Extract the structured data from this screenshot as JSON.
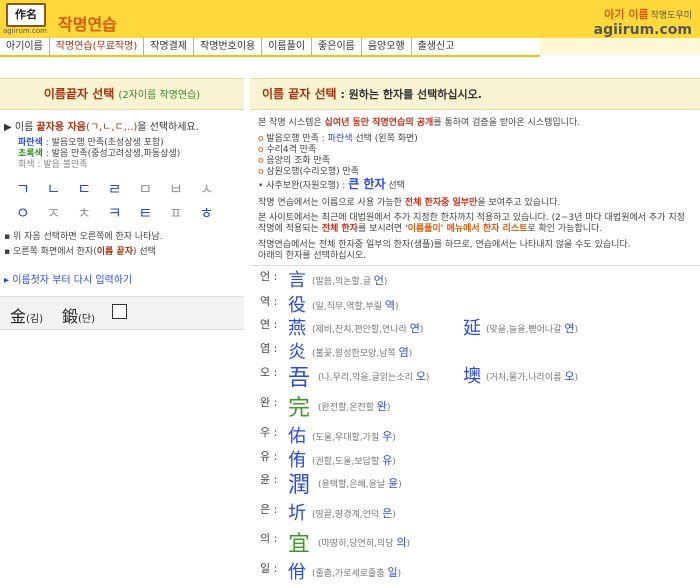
{
  "header": {
    "logo_hanja": "作名",
    "logo_url": "agiirum.com",
    "site_title": "작명연습",
    "brand_name": "아기 이름",
    "brand_tag": "작명도우미",
    "brand_url": "agiirum.com"
  },
  "nav": [
    "아기이름",
    "작명연습(무료작명)",
    "작명결제",
    "작명번호이용",
    "이름풀이",
    "좋은이름",
    "음양오행",
    "출생신고"
  ],
  "left": {
    "title": "이름끝자 선택",
    "title_sub": "(2자이름 작명연습)",
    "step_prefix": "▶ 이름 ",
    "step_bold": "끝자용 자음",
    "step_jamo": "(ㄱ,ㄴ,ㄷ,..)",
    "step_suffix": "을 선택하세요.",
    "desc_blue_label": "파란색",
    "desc_blue_text": " : 발음오행 만족(초성상생 포함)",
    "desc_green_label": "초록색",
    "desc_green_text": " : 발음 만족(중성고려상생,파동상생)",
    "desc_gray_label": "회색",
    "desc_gray_text": " : 발음 불만족",
    "jamo_row1": [
      "ㄱ",
      "ㄴ",
      "ㄷ",
      "ㄹ",
      "ㅁ",
      "ㅂ",
      "ㅅ"
    ],
    "jamo_row2": [
      "ㅇ",
      "ㅈ",
      "ㅊ",
      "ㅋ",
      "ㅌ",
      "ㅍ",
      "ㅎ"
    ],
    "note1": "▪ 위 자음 선택하면 오른쪽에 한자 나타남.",
    "note2_pre": "▪ 오른쪽 화면에서 한자(",
    "note2_b": "이름 끝자",
    "note2_post": ") 선택",
    "restart": "▸ 이름첫자 부터 다시 입력하기",
    "sel1_hanja": "金",
    "sel1_reading": "(김)",
    "sel2_hanja": "鍛",
    "sel2_reading": "(단)"
  },
  "right": {
    "title": "이름 끝자 선택",
    "title_rest": " : 원하는 한자를 선택하십시오.",
    "p1_pre": "본 작명 시스템은 ",
    "p1_red": "십여년 동안 작명연습의 공개",
    "p1_post": "를 통하여 검증을 받아온 시스템입니다.",
    "check1_pre": "발음오행 만족 : ",
    "check1_blue": "파란색",
    "check1_post": " 선택 (왼쪽 화면)",
    "check2": "수리4격 만족",
    "check3": "음양의 조화 만족",
    "check4": "삼원오행(수리오행) 만족",
    "check5_pre": "• 사주보완(자원오행) : ",
    "check5_b": "큰 한자",
    "check5_post": " 선택",
    "p2_pre": "작명 연습에서는 이름으로 사용 가능한 ",
    "p2_red": "전체 한자중 일부만",
    "p2_post": "을 보여주고 있습니다.",
    "p3a": "본 사이트에서는 최근에 대법원에서 추가 지정한 한자까지 적용하고 있습니다. (2~3년 마다 대법원에서 추가 지정",
    "p3b_pre": "작명에 적용되는 ",
    "p3b_red": "전체 한자",
    "p3b_mid": "를 보시려면 '",
    "p3b_orange": "이름풀이' 메뉴에서 한자 리스트",
    "p3b_post": "로 확인 가능합니다.",
    "p4": "작명연습에서는 전체 한자중 일부의 한자(샘플)를 하므로, 연습에서는 나타내지 않을 수도 있습니다.",
    "p5": "아래의 한자를 선택하십시오.",
    "rows": [
      {
        "sound": "언 :",
        "items": [
          {
            "hanja": "言",
            "color": "#2a4bd6",
            "big": false,
            "meaning": "(말씀,의논할,글 ",
            "reading": "언",
            ")": ""
          }
        ]
      },
      {
        "sound": "역 :",
        "items": [
          {
            "hanja": "役",
            "color": "#2a4bd6",
            "big": false,
            "meaning": "(일,직무,역할,부릴 ",
            "reading": "역"
          }
        ]
      },
      {
        "sound": "연 :",
        "items": [
          {
            "hanja": "燕",
            "color": "#2a4bd6",
            "big": false,
            "meaning": "(제비,잔치,편안할,연나라 ",
            "reading": "연"
          },
          {
            "hanja": "延",
            "color": "#2a4bd6",
            "big": false,
            "meaning": "(맞을,늘을,뻗어나갈 ",
            "reading": "연"
          }
        ]
      },
      {
        "sound": "염 :",
        "items": [
          {
            "hanja": "炎",
            "color": "#2a4bd6",
            "big": false,
            "meaning": "(불꽃,왕성한모양,남쪽 ",
            "reading": "염"
          }
        ]
      },
      {
        "sound": "오 :",
        "items": [
          {
            "hanja": "吾",
            "color": "#2a4bd6",
            "big": true,
            "meaning": "(나,우리,막을,글읽는소리 ",
            "reading": "오"
          },
          {
            "hanja": "墺",
            "color": "#2a4bd6",
            "big": false,
            "meaning": "(거처,물가,나라이름 ",
            "reading": "오"
          }
        ]
      },
      {
        "sound": "완 :",
        "items": [
          {
            "hanja": "完",
            "color": "#3d9a2a",
            "big": true,
            "meaning": "(완전할,온전할 ",
            "reading": "완"
          }
        ]
      },
      {
        "sound": "우 :",
        "items": [
          {
            "hanja": "佑",
            "color": "#2a4bd6",
            "big": false,
            "meaning": "(도울,우대할,가질 ",
            "reading": "우"
          }
        ]
      },
      {
        "sound": "유 :",
        "items": [
          {
            "hanja": "侑",
            "color": "#2a4bd6",
            "big": false,
            "meaning": "(권할,도울,보답할 ",
            "reading": "유"
          }
        ]
      },
      {
        "sound": "윤 :",
        "items": [
          {
            "hanja": "潤",
            "color": "#2a4bd6",
            "big": true,
            "meaning": "(윤택할,은혜,윤날 ",
            "reading": "윤"
          }
        ]
      },
      {
        "sound": "은 :",
        "items": [
          {
            "hanja": "圻",
            "color": "#2a4bd6",
            "big": false,
            "meaning": "(땅끝,땅경계,언덕 ",
            "reading": "은"
          }
        ]
      },
      {
        "sound": "의 :",
        "items": [
          {
            "hanja": "宜",
            "color": "#3d9a2a",
            "big": true,
            "meaning": "(마땅히,당연히,의당 ",
            "reading": "의"
          }
        ]
      },
      {
        "sound": "일 :",
        "items": [
          {
            "hanja": "佾",
            "color": "#2a4bd6",
            "big": false,
            "meaning": "(줄춤,가로세로줄춤 ",
            "reading": "일"
          }
        ]
      }
    ]
  },
  "colors": {
    "header_bg": "#ffd93b",
    "accent": "#d45a0c",
    "blue": "#2a4bd6",
    "green": "#3d9a2a",
    "panel_head": "#f8f3d2"
  }
}
